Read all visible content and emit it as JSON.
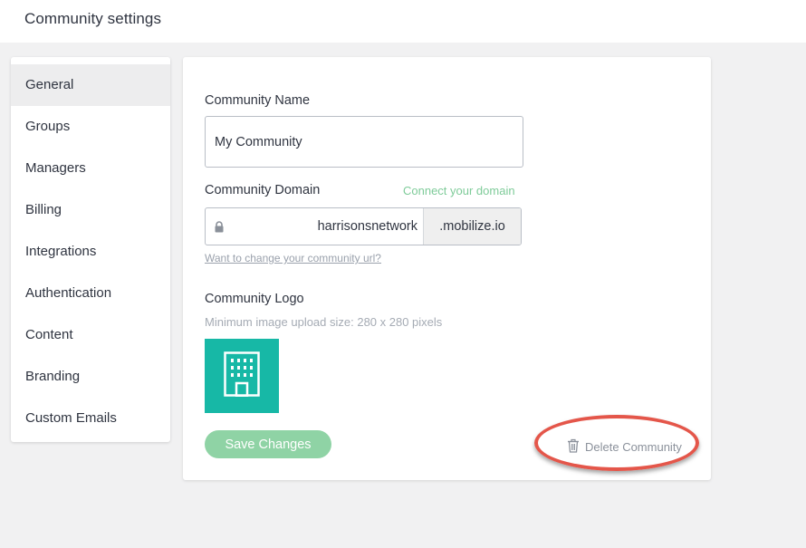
{
  "header": {
    "title": "Community settings"
  },
  "sidebar": {
    "items": [
      {
        "label": "General",
        "active": true
      },
      {
        "label": "Groups"
      },
      {
        "label": "Managers"
      },
      {
        "label": "Billing"
      },
      {
        "label": "Integrations"
      },
      {
        "label": "Authentication"
      },
      {
        "label": "Content"
      },
      {
        "label": "Branding"
      },
      {
        "label": "Custom Emails"
      }
    ]
  },
  "form": {
    "name_label": "Community Name",
    "name_value": "My Community",
    "domain_label": "Community Domain",
    "connect_domain": "Connect your domain",
    "domain_value": "harrisonsnetwork",
    "domain_suffix": ".mobilize.io",
    "change_url": "Want to change your community url?",
    "logo_label": "Community Logo",
    "logo_hint": "Minimum image upload size: 280 x 280 pixels",
    "save_label": "Save Changes",
    "delete_label": "Delete Community"
  },
  "icons": {
    "lock": "lock-icon",
    "logo": "building-icon",
    "trash": "trash-icon"
  },
  "colors": {
    "accent_green": "#8fd3a5",
    "link_green": "#7ecb99",
    "logo_teal": "#17b8a6",
    "highlight_red": "#e4564a"
  }
}
